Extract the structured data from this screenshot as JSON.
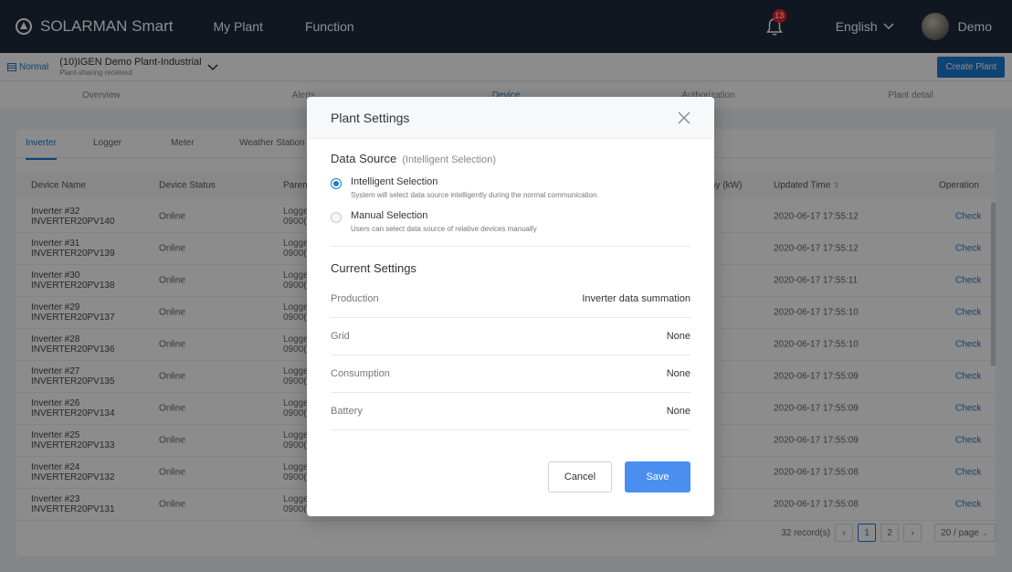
{
  "topbar": {
    "brand": "SOLARMAN Smart",
    "nav": [
      "My Plant",
      "Function"
    ],
    "notification_count": "13",
    "language": "English",
    "user": "Demo"
  },
  "plantbar": {
    "status": "Normal",
    "plant_name": "(10)IGEN Demo Plant-Industrial",
    "plant_sub": "Plant-sharing received",
    "create_button": "Create Plant"
  },
  "page_tabs": [
    "Overview",
    "Alerts",
    "Device",
    "Authorization",
    "Plant detail"
  ],
  "device_tabs": [
    "Inverter",
    "Logger",
    "Meter",
    "Weather Station"
  ],
  "table": {
    "headers": {
      "device_name": "Device Name",
      "device_status": "Device Status",
      "parent": "Paren",
      "today": "ay (kW)",
      "updated": "Updated Time",
      "operation": "Operation"
    },
    "rows": [
      {
        "name1": "Inverter #32",
        "name2": "INVERTER20PV140",
        "status": "Online",
        "parent1": "Logge",
        "parent2": "0900(",
        "time": "2020-06-17 17:55:12",
        "op": "Check"
      },
      {
        "name1": "Inverter #31",
        "name2": "INVERTER20PV139",
        "status": "Online",
        "parent1": "Logge",
        "parent2": "0900(",
        "time": "2020-06-17 17:55:12",
        "op": "Check"
      },
      {
        "name1": "Inverter #30",
        "name2": "INVERTER20PV138",
        "status": "Online",
        "parent1": "Logge",
        "parent2": "0900(",
        "time": "2020-06-17 17:55:11",
        "op": "Check"
      },
      {
        "name1": "Inverter #29",
        "name2": "INVERTER20PV137",
        "status": "Online",
        "parent1": "Logge",
        "parent2": "0900(",
        "time": "2020-06-17 17:55:10",
        "op": "Check"
      },
      {
        "name1": "Inverter #28",
        "name2": "INVERTER20PV136",
        "status": "Online",
        "parent1": "Logge",
        "parent2": "0900(",
        "time": "2020-06-17 17:55:10",
        "op": "Check"
      },
      {
        "name1": "Inverter #27",
        "name2": "INVERTER20PV135",
        "status": "Online",
        "parent1": "Logge",
        "parent2": "0900(",
        "time": "2020-06-17 17:55:09",
        "op": "Check"
      },
      {
        "name1": "Inverter #26",
        "name2": "INVERTER20PV134",
        "status": "Online",
        "parent1": "Logge",
        "parent2": "0900(",
        "time": "2020-06-17 17:55:09",
        "op": "Check"
      },
      {
        "name1": "Inverter #25",
        "name2": "INVERTER20PV133",
        "status": "Online",
        "parent1": "Logge",
        "parent2": "0900(",
        "time": "2020-06-17 17:55:09",
        "op": "Check"
      },
      {
        "name1": "Inverter #24",
        "name2": "INVERTER20PV132",
        "status": "Online",
        "parent1": "Logge",
        "parent2": "0900(",
        "time": "2020-06-17 17:55:08",
        "op": "Check"
      },
      {
        "name1": "Inverter #23",
        "name2": "INVERTER20PV131",
        "status": "Online",
        "parent1": "Logge",
        "parent2": "0900(",
        "time": "2020-06-17 17:55:08",
        "op": "Check"
      }
    ]
  },
  "pagination": {
    "records": "32 record(s)",
    "pages": [
      "1",
      "2"
    ],
    "page_size": "20 / page"
  },
  "modal": {
    "title": "Plant Settings",
    "data_source_title": "Data Source",
    "data_source_hint": "(Intelligent Selection)",
    "option1_label": "Intelligent Selection",
    "option1_desc": "System will select data source intelligently during the normal communication.",
    "option2_label": "Manual Selection",
    "option2_desc": "Users can select data source of relative devices manually",
    "current_title": "Current Settings",
    "settings": [
      {
        "key": "Production",
        "value": "Inverter data summation"
      },
      {
        "key": "Grid",
        "value": "None"
      },
      {
        "key": "Consumption",
        "value": "None"
      },
      {
        "key": "Battery",
        "value": "None"
      }
    ],
    "cancel": "Cancel",
    "save": "Save"
  },
  "colors": {
    "topbar": "#1f2b3d",
    "accent": "#1a7bd6",
    "save_button": "#4a8ff0"
  }
}
